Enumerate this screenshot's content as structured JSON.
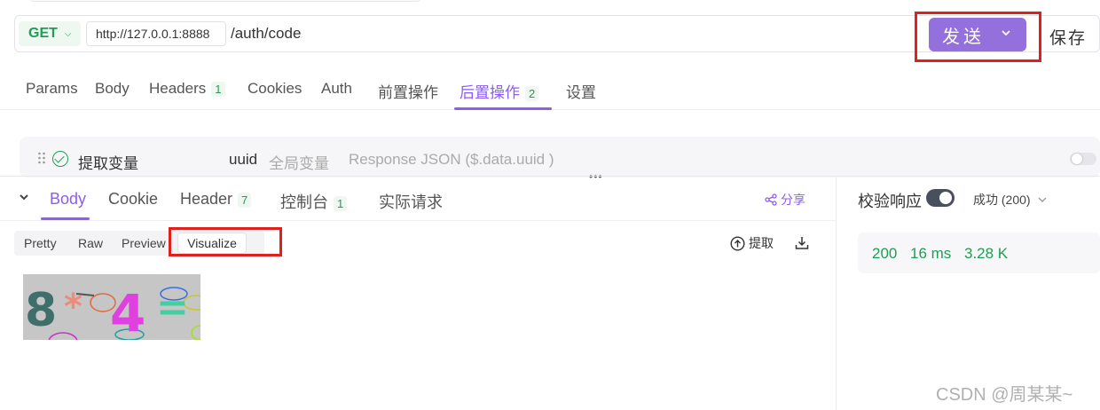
{
  "request": {
    "method": "GET",
    "host": "http://127.0.0.1:8888",
    "path": "/auth/code",
    "send_label": "发送",
    "save_label": "保存"
  },
  "request_tabs": [
    {
      "label": "Params"
    },
    {
      "label": "Body"
    },
    {
      "label": "Headers",
      "count": "1"
    },
    {
      "label": "Cookies"
    },
    {
      "label": "Auth"
    },
    {
      "label": "前置操作"
    },
    {
      "label": "后置操作",
      "count": "2",
      "active": true
    },
    {
      "label": "设置"
    }
  ],
  "post_operation": {
    "title": "提取变量",
    "variable": "uuid",
    "scope": "全局变量",
    "source": "Response JSON ($.data.uuid )"
  },
  "response_tabs": [
    {
      "label": "Body",
      "active": true
    },
    {
      "label": "Cookie"
    },
    {
      "label": "Header",
      "count": "7"
    },
    {
      "label": "控制台",
      "count": "1"
    },
    {
      "label": "实际请求"
    }
  ],
  "share_label": "分享",
  "view_modes": [
    "Pretty",
    "Raw",
    "Preview",
    "Visualize"
  ],
  "active_view_mode": "Visualize",
  "extract_label": "提取",
  "captcha": {
    "chars": [
      "8",
      "*",
      "4",
      "="
    ]
  },
  "right_panel": {
    "verify_label": "校验响应",
    "status_text": "成功 (200)",
    "status_code": "200",
    "time": "16 ms",
    "size": "3.28 K"
  },
  "watermark": "CSDN @周某某~",
  "colors": {
    "accent": "#8b5cf6",
    "send_button": "#9370db",
    "success": "#1f9d55",
    "highlight_box": "#e0201f"
  }
}
